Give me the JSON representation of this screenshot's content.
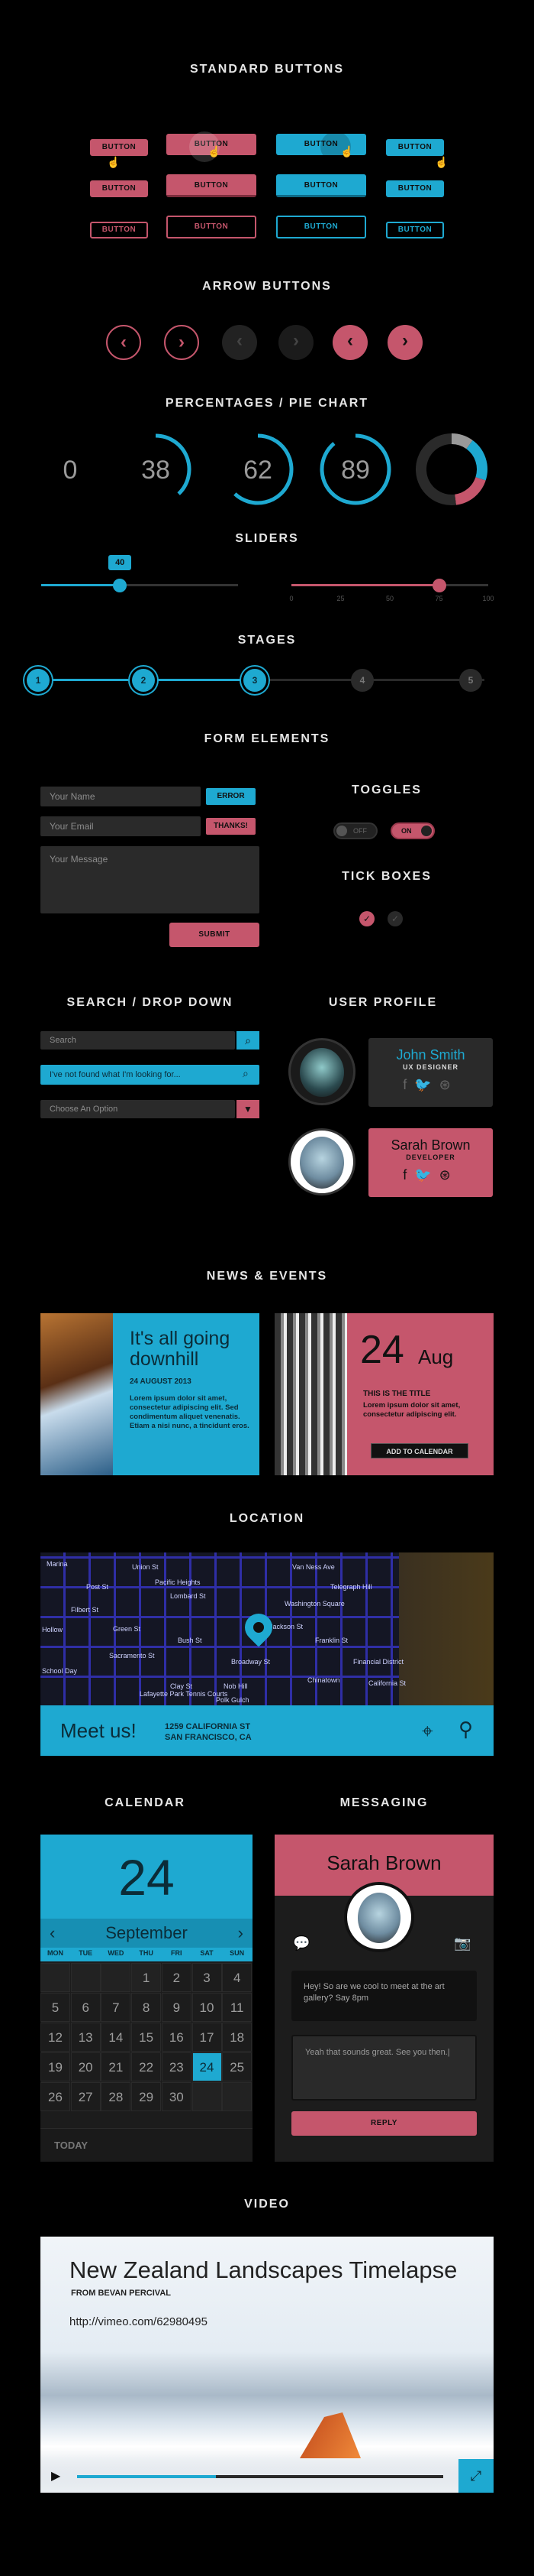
{
  "sections": {
    "standard_buttons": "STANDARD BUTTONS",
    "arrow_buttons": "ARROW BUTTONS",
    "percentages": "PERCENTAGES / PIE CHART",
    "sliders": "SLIDERS",
    "stages": "STAGES",
    "form_elements": "FORM ELEMENTS",
    "toggles": "TOGGLES",
    "tick_boxes": "TICK BOXES",
    "search_dropdown": "SEARCH / DROP DOWN",
    "user_profile": "USER PROFILE",
    "news_events": "NEWS & EVENTS",
    "location": "LOCATION",
    "calendar": "CALENDAR",
    "messaging": "MESSAGING",
    "video": "VIDEO"
  },
  "buttons": {
    "label": "BUTTON"
  },
  "percentages": {
    "values": [
      "0",
      "38",
      "62",
      "89"
    ],
    "fills": [
      0,
      0.38,
      0.62,
      0.89
    ]
  },
  "sliders": {
    "value": "40",
    "left_level": 0.4,
    "right_level": 0.75,
    "ticks": [
      "0",
      "25",
      "50",
      "75",
      "100"
    ]
  },
  "stages": {
    "labels": [
      "1",
      "2",
      "3",
      "4",
      "5"
    ],
    "current": 3
  },
  "form": {
    "name_placeholder": "Your Name",
    "name_status": "ERROR",
    "email_placeholder": "Your Email",
    "email_status": "THANKS!",
    "message_placeholder": "Your Message",
    "submit": "SUBMIT"
  },
  "toggles": {
    "off": "OFF",
    "on": "ON"
  },
  "search": {
    "placeholder": "Search",
    "query": "I've not found what I'm looking for...",
    "dropdown": "Choose An Option"
  },
  "profiles": [
    {
      "name": "John Smith",
      "role": "UX DESIGNER"
    },
    {
      "name": "Sarah Brown",
      "role": "DEVELOPER"
    }
  ],
  "news": {
    "title": "It's all going downhill",
    "date": "24 AUGUST 2013",
    "body": "Lorem ipsum dolor sit amet, consectetur adipiscing elit. Sed condimentum aliquet venenatis. Etiam a nisi nunc, a tincidunt eros."
  },
  "event": {
    "day": "24",
    "month": "Aug",
    "title": "THIS IS THE TITLE",
    "body": "Lorem ipsum dolor sit amet, consectetur adipiscing elit.",
    "button": "ADD TO CALENDAR"
  },
  "map": {
    "labels": [
      "Marina",
      "Pacific Heights",
      "Lombard St",
      "Filbert St",
      "Union St",
      "Green St",
      "Hollow",
      "Telegraph Hill",
      "Washington Square",
      "Broadway St",
      "Jackson St",
      "Clay St",
      "Nob Hill",
      "Chinatown",
      "Financial District",
      "Lafayette Park Tennis Courts",
      "Polk Gulch",
      "School Day",
      "California St",
      "Van Ness Ave",
      "Franklin St",
      "Sacramento St",
      "Bush St",
      "Post St"
    ],
    "meet": "Meet us!",
    "address1": "1259 CALIFORNIA ST",
    "address2": "SAN FRANCISCO, CA"
  },
  "calendar": {
    "day": "24",
    "month": "September",
    "weekdays": [
      "MON",
      "TUE",
      "WED",
      "THU",
      "FRI",
      "SAT",
      "SUN"
    ],
    "rows": [
      [
        "",
        "",
        "",
        "",
        "1",
        "2",
        "3",
        "4"
      ],
      [
        "5",
        "6",
        "7",
        "8",
        "9",
        "10",
        "11"
      ],
      [
        "12",
        "13",
        "14",
        "15",
        "16",
        "17",
        "18"
      ],
      [
        "19",
        "20",
        "21",
        "22",
        "23",
        "24",
        "25"
      ],
      [
        "26",
        "27",
        "28",
        "29",
        "30",
        "",
        ""
      ]
    ],
    "today": "TODAY",
    "selected": "24"
  },
  "messaging": {
    "name": "Sarah Brown",
    "msg1": "Hey! So are we cool to meet at the art gallery? Say 8pm",
    "msg2": "Yeah that sounds great. See you then.|",
    "reply": "REPLY"
  },
  "video": {
    "title": "New Zealand Landscapes Timelapse",
    "author": "FROM BEVAN PERCIVAL",
    "url": "http://vimeo.com/62980495",
    "progress": 0.38
  },
  "colors": {
    "pink": "#c5566c",
    "blue": "#1ea9d1",
    "dark": "#1c1c1c"
  },
  "icons": [
    "pointer-cursor-icon",
    "chevron-left-icon",
    "chevron-right-icon",
    "checkmark-icon",
    "search-icon",
    "caret-down-icon",
    "facebook-icon",
    "twitter-icon",
    "dribbble-icon",
    "map-pin-icon",
    "crosshair-icon",
    "chat-bubble-icon",
    "camera-icon",
    "play-icon",
    "fullscreen-icon"
  ]
}
